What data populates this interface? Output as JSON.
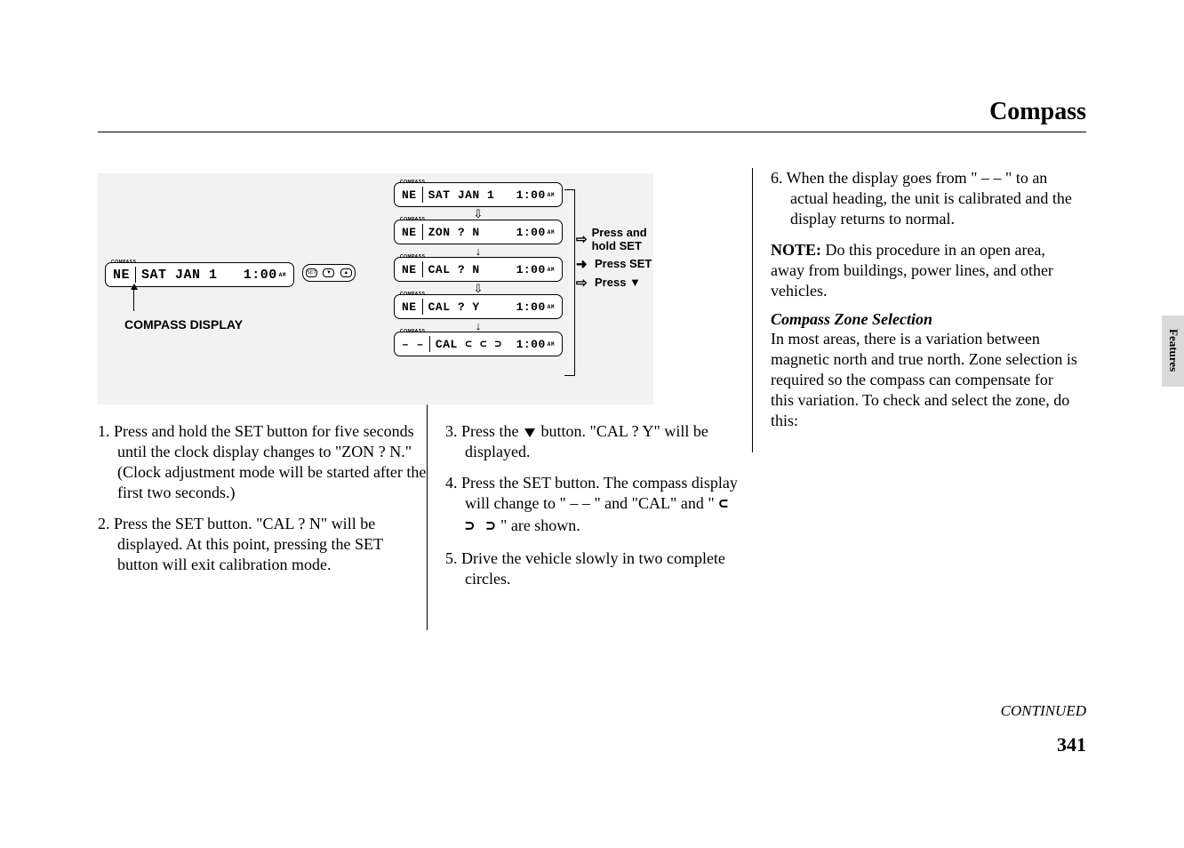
{
  "title": "Compass",
  "figure": {
    "main_display": {
      "compass_tag": "COMPASS",
      "left": "NE",
      "mid": "SAT JAN   1",
      "right": "1:00",
      "ampm": "AM"
    },
    "button_cluster": [
      "SET",
      "▼",
      "▲"
    ],
    "compass_display_label": "COMPASS DISPLAY",
    "stack": [
      {
        "tag": "COMPASS",
        "l": "NE",
        "m": "SAT JAN   1",
        "r": "1:00",
        "am": "AM"
      },
      {
        "tag": "COMPASS",
        "l": "NE",
        "m": "ZON ? N",
        "r": "1:00",
        "am": "AM"
      },
      {
        "tag": "COMPASS",
        "l": "NE",
        "m": "CAL ? N",
        "r": "1:00",
        "am": "AM"
      },
      {
        "tag": "COMPASS",
        "l": "NE",
        "m": "CAL ? Y",
        "r": "1:00",
        "am": "AM"
      },
      {
        "tag": "COMPASS",
        "l": "– –",
        "m": "CAL ⊂ ⊂ ⊃",
        "r": "1:00",
        "am": "AM"
      }
    ],
    "stack_arrows": [
      "⇩",
      "↓",
      "⇩",
      "↓"
    ],
    "annotations": [
      {
        "arrow": "⇨",
        "text": "Press and hold SET"
      },
      {
        "arrow": "➜",
        "text": "Press SET"
      },
      {
        "arrow": "⇨",
        "text": "Press ▼"
      }
    ]
  },
  "col1_items": [
    "1. Press and hold the SET button for five seconds until the clock display changes to \"ZON ? N.\" (Clock adjustment mode will be started after the first two seconds.)",
    "2. Press the SET button. \"CAL ? N\" will be displayed. At this point, pressing the SET button will exit calibration mode."
  ],
  "col2_items": {
    "i3_pre": "3. Press the ",
    "i3_post": " button. \"CAL ? Y\" will be displayed.",
    "i4_pre": "4. Press the SET button. The compass display will change to \" – – \" and \"CAL\" and \" ",
    "i4_sym": "⊂ ⊃ ⊃",
    "i4_post": " \" are shown.",
    "i5": "5. Drive the vehicle slowly in two complete circles."
  },
  "col3": {
    "i6": "6. When the display goes from \" – – \" to an actual heading, the unit is calibrated and the display returns to normal.",
    "note_label": "NOTE:",
    "note_text": " Do this procedure in an open area, away from buildings, power lines, and other vehicles.",
    "subhead": "Compass Zone Selection",
    "para": "In most areas, there is a variation between magnetic north and true north. Zone selection is required so the compass can compensate for this variation. To check and select the zone, do this:"
  },
  "side_tab": "Features",
  "continued": "CONTINUED",
  "page_number": "341"
}
